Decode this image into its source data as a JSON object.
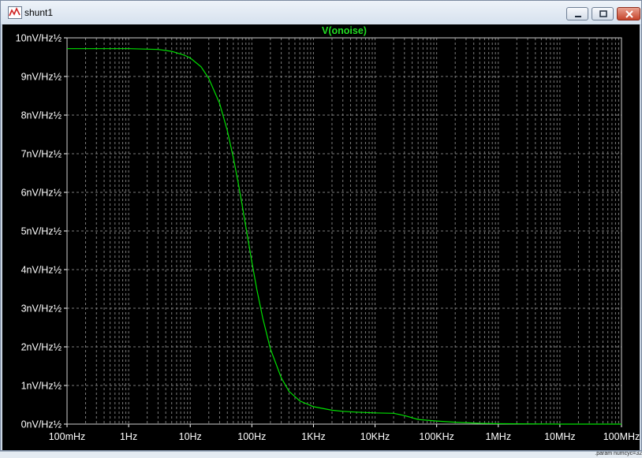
{
  "window": {
    "title": "shunt1",
    "icon": "waveform-icon",
    "controls": [
      "minimize-icon",
      "maximize-icon",
      "close-icon"
    ]
  },
  "status": {
    "text": ".param numcyc=32"
  },
  "colors": {
    "trace": "#00e000",
    "title": "#22dd22",
    "grid": "#7a7a7a",
    "axis_text": "#ffffff",
    "background": "#000000"
  },
  "chart_data": {
    "type": "line",
    "title": "V(onoise)",
    "xlabel": "",
    "ylabel": "",
    "x_scale": "log",
    "xlim": [
      0.1,
      100000000
    ],
    "ylim": [
      0,
      10
    ],
    "grid": true,
    "x_ticks": [
      {
        "value": 0.1,
        "label": "100mHz"
      },
      {
        "value": 1,
        "label": "1Hz"
      },
      {
        "value": 10,
        "label": "10Hz"
      },
      {
        "value": 100,
        "label": "100Hz"
      },
      {
        "value": 1000,
        "label": "1KHz"
      },
      {
        "value": 10000,
        "label": "10KHz"
      },
      {
        "value": 100000,
        "label": "100KHz"
      },
      {
        "value": 1000000,
        "label": "1MHz"
      },
      {
        "value": 10000000,
        "label": "10MHz"
      },
      {
        "value": 100000000,
        "label": "100MHz"
      }
    ],
    "y_ticks": [
      {
        "value": 0,
        "label": "0nV/Hz½"
      },
      {
        "value": 1,
        "label": "1nV/Hz½"
      },
      {
        "value": 2,
        "label": "2nV/Hz½"
      },
      {
        "value": 3,
        "label": "3nV/Hz½"
      },
      {
        "value": 4,
        "label": "4nV/Hz½"
      },
      {
        "value": 5,
        "label": "5nV/Hz½"
      },
      {
        "value": 6,
        "label": "6nV/Hz½"
      },
      {
        "value": 7,
        "label": "7nV/Hz½"
      },
      {
        "value": 8,
        "label": "8nV/Hz½"
      },
      {
        "value": 9,
        "label": "9nV/Hz½"
      },
      {
        "value": 10,
        "label": "10nV/Hz½"
      }
    ],
    "series": [
      {
        "x": [
          0.1,
          1,
          3,
          5,
          8,
          10,
          15,
          20,
          30,
          40,
          50,
          60,
          70,
          80,
          100,
          120,
          150,
          200,
          300,
          400,
          600,
          1000,
          2000,
          3000,
          5000,
          10000,
          20000,
          30000,
          50000,
          100000,
          200000,
          500000,
          1000000,
          10000000,
          100000000
        ],
        "y": [
          9.72,
          9.72,
          9.7,
          9.65,
          9.55,
          9.48,
          9.25,
          8.95,
          8.3,
          7.6,
          6.9,
          6.25,
          5.65,
          5.1,
          4.2,
          3.5,
          2.75,
          1.95,
          1.2,
          0.85,
          0.6,
          0.45,
          0.36,
          0.33,
          0.31,
          0.29,
          0.28,
          0.22,
          0.12,
          0.08,
          0.05,
          0.02,
          0.01,
          0.0,
          0.0
        ]
      }
    ]
  }
}
